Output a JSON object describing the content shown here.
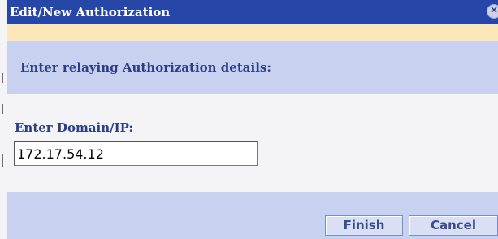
{
  "window": {
    "title": "Edit/New Authorization",
    "close_icon": "close-circle-icon"
  },
  "section": {
    "heading": "Enter relaying Authorization details:"
  },
  "form": {
    "domain_label": "Enter Domain/IP:",
    "domain_value": "172.17.54.12"
  },
  "buttons": {
    "finish_label": "Finish",
    "cancel_label": "Cancel"
  },
  "colors": {
    "titlebar": "#2646a8",
    "message_bar": "#fbe7b8",
    "band": "#c9d1f0",
    "label_text": "#2c3f82"
  }
}
